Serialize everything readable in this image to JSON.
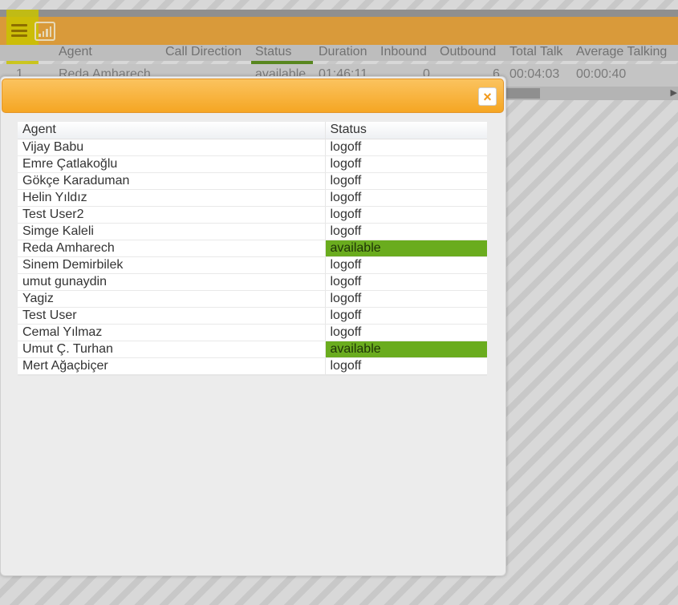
{
  "background": {
    "columns": [
      "Agent",
      "Call Direction",
      "Status",
      "Duration",
      "Inbound",
      "Outbound",
      "Total Talk",
      "Average Talking"
    ],
    "row": {
      "index": "1",
      "agent": "Reda Amharech",
      "status": "available",
      "duration": "01:46:11",
      "inbound": "0",
      "outbound": "6",
      "total_talk": "00:04:03",
      "average_talking": "00:00:40"
    }
  },
  "dialog": {
    "close_label": "×",
    "columns": {
      "agent": "Agent",
      "status": "Status"
    },
    "rows": [
      {
        "agent": "Vijay Babu",
        "status": "logoff"
      },
      {
        "agent": "Emre Çatlakoğlu",
        "status": "logoff"
      },
      {
        "agent": "Gökçe Karaduman",
        "status": "logoff"
      },
      {
        "agent": "Helin Yıldız",
        "status": "logoff"
      },
      {
        "agent": "Test User2",
        "status": "logoff"
      },
      {
        "agent": "Simge Kaleli",
        "status": "logoff"
      },
      {
        "agent": "Reda Amharech",
        "status": "available"
      },
      {
        "agent": "Sinem Demirbilek",
        "status": "logoff"
      },
      {
        "agent": "umut gunaydin",
        "status": "logoff"
      },
      {
        "agent": "Yagiz",
        "status": "logoff"
      },
      {
        "agent": "Test User",
        "status": "logoff"
      },
      {
        "agent": "Cemal Yılmaz",
        "status": "logoff"
      },
      {
        "agent": "Umut Ç. Turhan",
        "status": "available"
      },
      {
        "agent": "Mert Ağaçbiçer",
        "status": "logoff"
      }
    ]
  },
  "colors": {
    "toolbar": "#d99a3a",
    "dialog_title": "#f5a623",
    "available": "#6aac1e"
  },
  "icons": [
    "menu-icon",
    "chart-icon",
    "close-icon"
  ]
}
